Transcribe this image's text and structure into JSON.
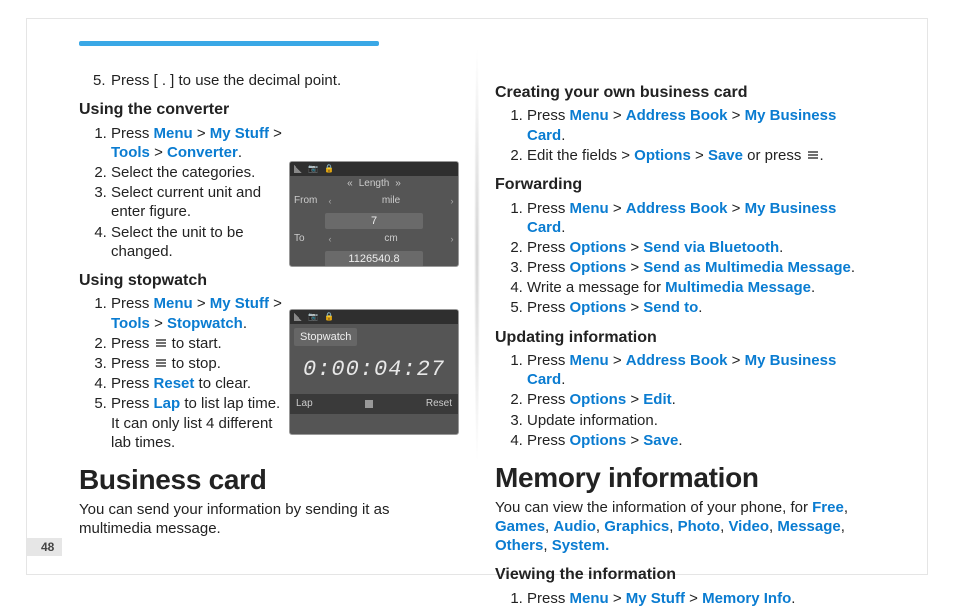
{
  "page_number": "48",
  "leftColumn": {
    "continued_step": "Press [ . ] to use the decimal point.",
    "converter": {
      "heading": "Using the converter",
      "steps_pre": "Press ",
      "nav": [
        "Menu",
        "My Stuff",
        "Tools",
        "Converter"
      ],
      "step2": "Select the categories.",
      "step3": "Select current unit and enter figure.",
      "step4": "Select the unit to be changed."
    },
    "stopwatch": {
      "heading": "Using stopwatch",
      "nav": [
        "Menu",
        "My Stuff",
        "Tools",
        "Stopwatch"
      ],
      "step2_pre": "Press ",
      "step2_post": " to start.",
      "step3_pre": "Press ",
      "step3_post": " to stop.",
      "step4_pre": "Press ",
      "step4_link": "Reset",
      "step4_post": " to clear.",
      "step5_pre": "Press ",
      "step5_link": "Lap",
      "step5_post": " to list lap time. It can only list 4 different lab times."
    },
    "business_card": {
      "heading": "Business card",
      "intro": "You can send your information by sending it as multimedia message."
    }
  },
  "rightColumn": {
    "creating": {
      "heading": "Creating your own business card",
      "s1": {
        "pre": "Press ",
        "nav": [
          "Menu",
          "Address Book",
          "My Business Card"
        ],
        "post": "."
      },
      "s2": {
        "pre": "Edit the fields > ",
        "nav": [
          "Options",
          "Save"
        ],
        "post": " or press ",
        "post2": "."
      }
    },
    "forwarding": {
      "heading": "Forwarding",
      "s1": {
        "pre": "Press ",
        "nav": [
          "Menu",
          "Address Book",
          "My Business Card"
        ],
        "post": "."
      },
      "s2": {
        "pre": "Press ",
        "nav": [
          "Options",
          "Send via Bluetooth"
        ],
        "post": "."
      },
      "s3": {
        "pre": "Press ",
        "nav": [
          "Options",
          "Send as Multimedia Message"
        ],
        "post": "."
      },
      "s4": {
        "pre": "Write a message for ",
        "link": "Multimedia Message",
        "post": "."
      },
      "s5": {
        "pre": "Press ",
        "nav": [
          "Options",
          "Send to"
        ],
        "post": "."
      }
    },
    "updating": {
      "heading": "Updating information",
      "s1": {
        "pre": "Press ",
        "nav": [
          "Menu",
          "Address Book",
          "My Business Card"
        ],
        "post": "."
      },
      "s2": {
        "pre": "Press ",
        "nav": [
          "Options",
          "Edit"
        ],
        "post": "."
      },
      "s3": "Update information.",
      "s4": {
        "pre": "Press ",
        "nav": [
          "Options",
          "Save"
        ],
        "post": "."
      }
    },
    "memory": {
      "heading": "Memory information",
      "intro_pre": "You can view the information of your phone, for ",
      "intro_links": [
        "Free",
        "Games",
        "Audio",
        "Graphics",
        "Photo",
        "Video",
        "Message",
        "Others",
        "System."
      ],
      "viewing_heading": "Viewing the information",
      "s1": {
        "pre": "Press ",
        "nav": [
          "Menu",
          "My Stuff",
          "Memory Info"
        ],
        "post": "."
      }
    }
  },
  "screenshots": {
    "converter": {
      "title": "Length",
      "from_unit": "mile",
      "from_value": "7",
      "to_unit": "cm",
      "to_value": "1126540.8"
    },
    "stopwatch": {
      "title": "Stopwatch",
      "time": "0:00:04:27",
      "left_soft": "Lap",
      "right_soft": "Reset"
    }
  }
}
